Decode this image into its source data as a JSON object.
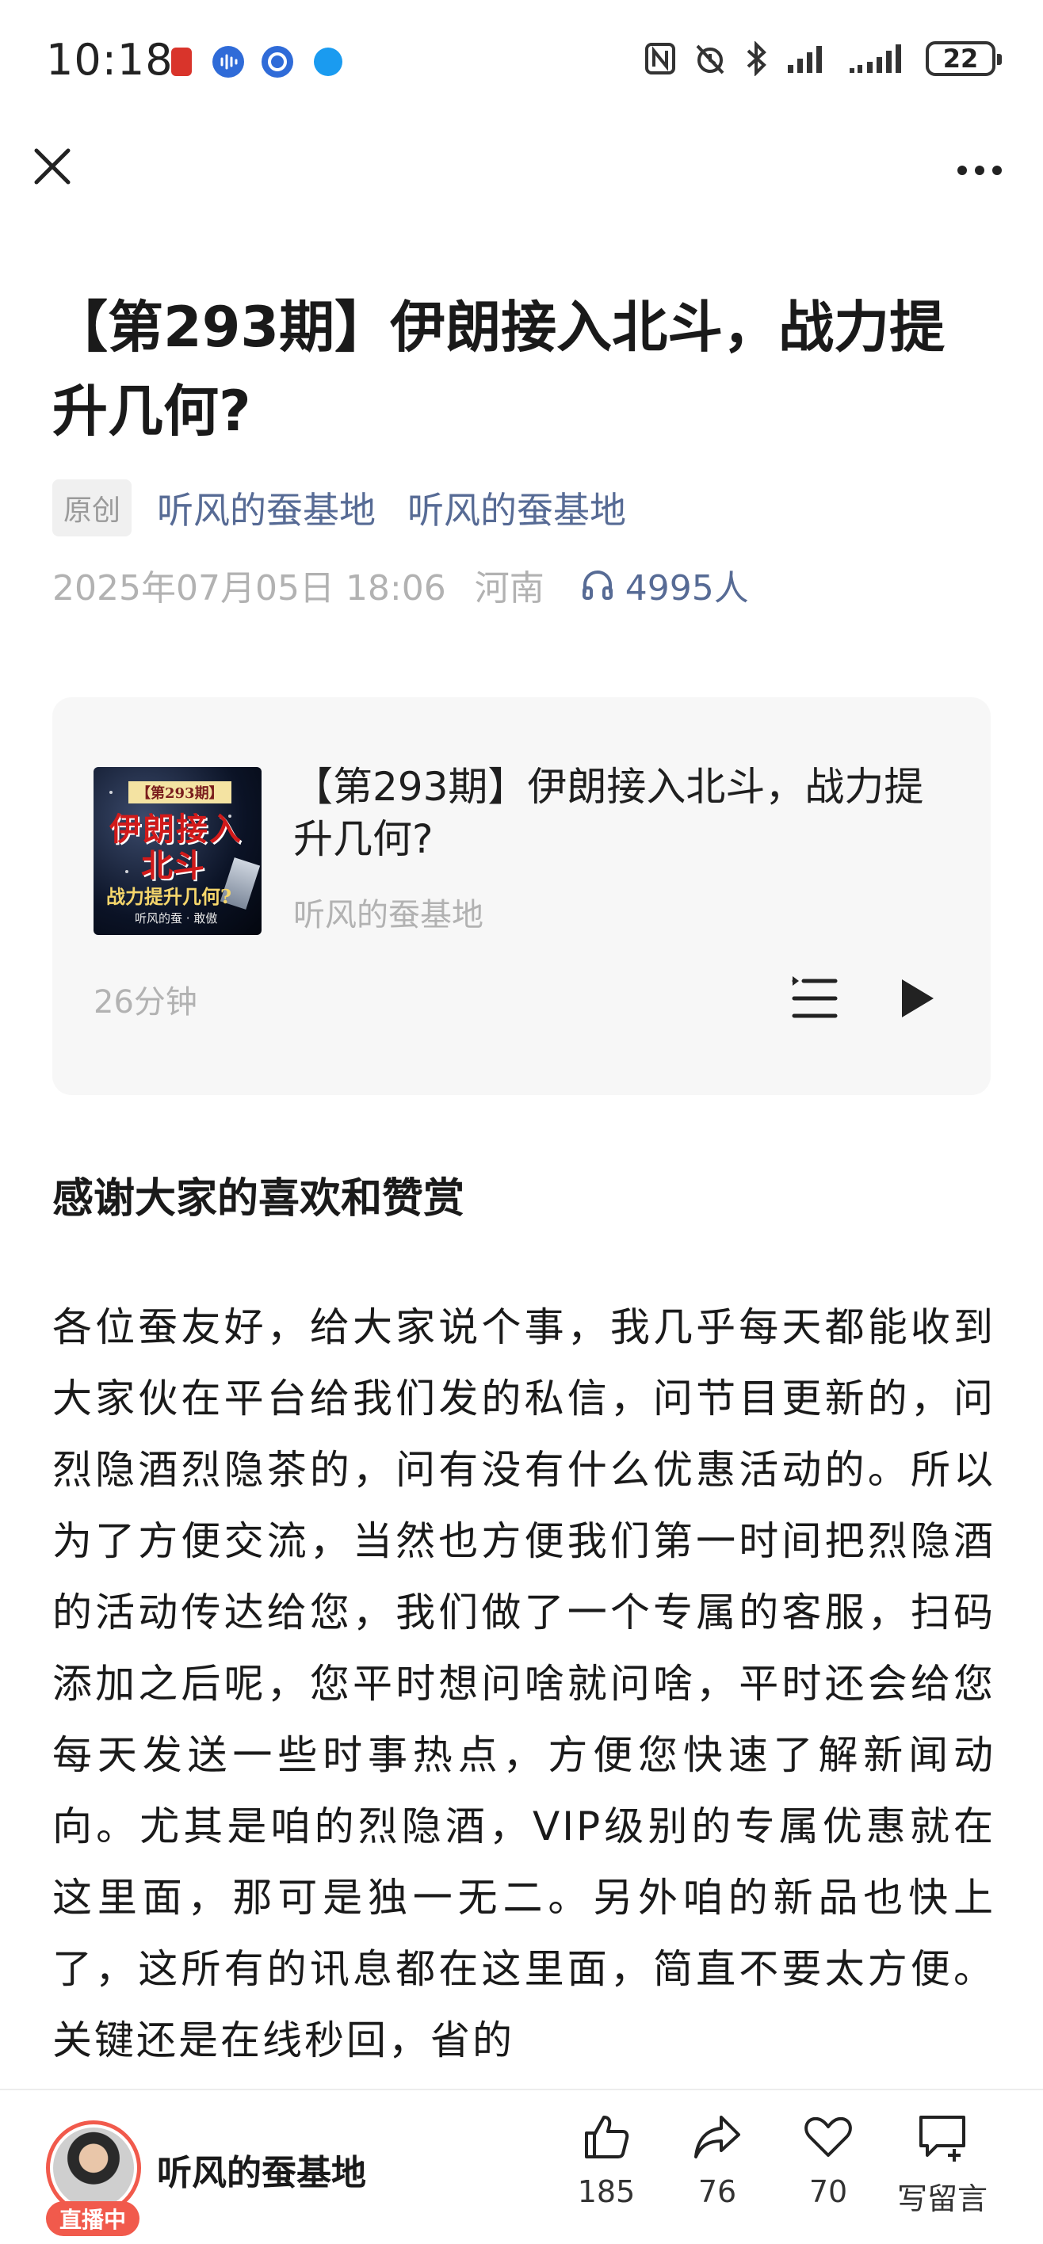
{
  "status_bar": {
    "time": "10:18",
    "battery": "22",
    "left_icons": [
      "app-notification-icon",
      "audio-app-icon",
      "browser-app-icon",
      "bluetooth-app-icon"
    ],
    "right_icons": [
      "nfc-icon",
      "alarm-icon",
      "bluetooth-icon",
      "signal-icon",
      "signal-icon-2",
      "battery-icon"
    ]
  },
  "nav": {
    "close_icon": "close-icon",
    "more_icon": "more-icon"
  },
  "article": {
    "title": "【第293期】伊朗接入北斗，战力提升几何?",
    "original_tag": "原创",
    "author_1": "听风的蚕基地",
    "author_2": "听风的蚕基地",
    "date": "2025年07月05日 18:06",
    "location": "河南",
    "listeners": "4995人"
  },
  "audio": {
    "title": "【第293期】伊朗接入北斗，战力提升几何?",
    "author": "听风的蚕基地",
    "duration": "26分钟",
    "cover": {
      "issue": "【第293期】",
      "line1": "伊朗接入",
      "line2": "北斗",
      "line3": "战力提升几何?",
      "credit": "听风的蚕 · 敢傲"
    }
  },
  "content": {
    "heading": "感谢大家的喜欢和赞赏",
    "paragraph": "各位蚕友好，给大家说个事，我几乎每天都能收到大家伙在平台给我们发的私信，问节目更新的，问烈隐酒烈隐茶的，问有没有什么优惠活动的。所以为了方便交流，当然也方便我们第一时间把烈隐酒的活动传达给您，我们做了一个专属的客服，扫码添加之后呢，您平时想问啥就问啥，平时还会给您每天发送一些时事热点，方便您快速了解新闻动向。尤其是咱的烈隐酒，VIP级别的专属优惠就在这里面，那可是独一无二。另外咱的新品也快上了，这所有的讯息都在这里面，简直不要太方便。关键还是在线秒回，省的"
  },
  "bottom_bar": {
    "author": "听风的蚕基地",
    "live_badge": "直播中",
    "like_count": "185",
    "share_count": "76",
    "favorite_count": "70",
    "comment_label": "写留言"
  },
  "colors": {
    "link": "#576b95",
    "meta_gray": "#b2b2b2",
    "live_red": "#f15a4c",
    "card_bg": "#f7f7f7"
  }
}
